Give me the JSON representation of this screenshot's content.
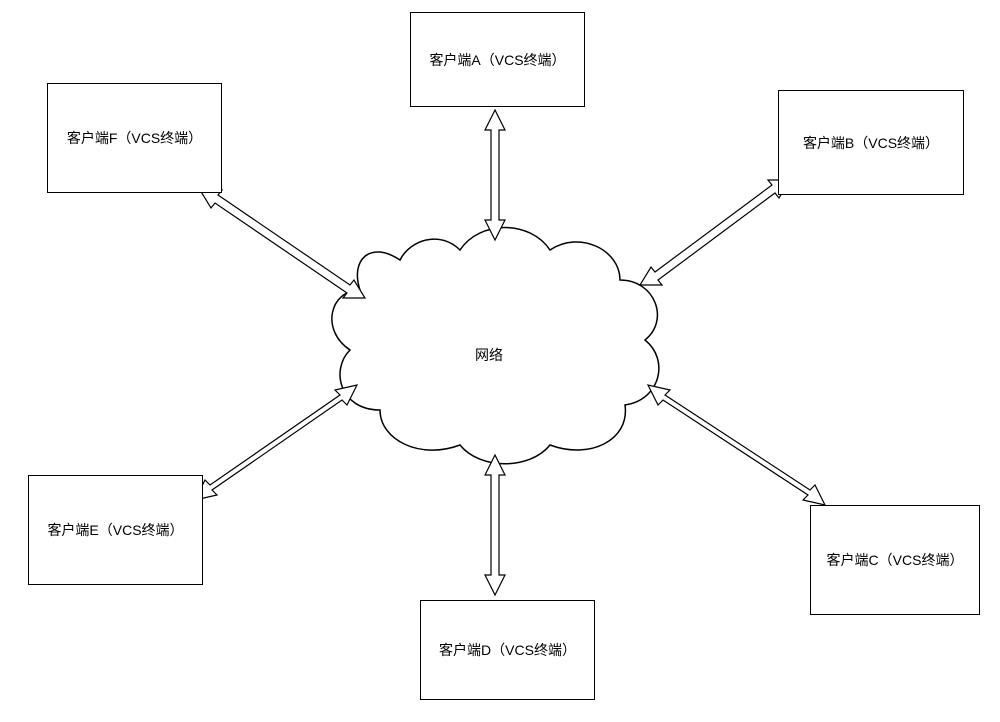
{
  "center": {
    "label": "网络"
  },
  "clients": {
    "a": "客户端A（VCS终端）",
    "b": "客户端B（VCS终端）",
    "c": "客户端C（VCS终端）",
    "d": "客户端D（VCS终端）",
    "e": "客户端E（VCS终端）",
    "f": "客户端F（VCS终端）"
  }
}
